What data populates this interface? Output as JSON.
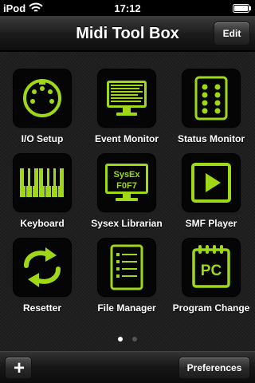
{
  "status_bar": {
    "carrier": "iPod",
    "time": "17:12",
    "wifi_icon": "wifi-icon",
    "battery_icon": "battery-icon"
  },
  "nav": {
    "title": "Midi Tool Box",
    "edit_label": "Edit"
  },
  "theme": {
    "accent": "#9ed816",
    "background": "#1c1c1c"
  },
  "tools": [
    {
      "label": "I/O Setup",
      "icon": "midi-din-connector-icon"
    },
    {
      "label": "Event Monitor",
      "icon": "monitor-binary-icon"
    },
    {
      "label": "Status Monitor",
      "icon": "status-lights-icon"
    },
    {
      "label": "Keyboard",
      "icon": "piano-keys-icon"
    },
    {
      "label": "Sysex Librarian",
      "icon": "sysex-monitor-icon",
      "icon_text": [
        "SysEx",
        "F0F7"
      ]
    },
    {
      "label": "SMF Player",
      "icon": "play-icon"
    },
    {
      "label": "Resetter",
      "icon": "reset-arrows-icon"
    },
    {
      "label": "File Manager",
      "icon": "file-list-icon"
    },
    {
      "label": "Program Change",
      "icon": "pc-notepad-icon",
      "icon_text": [
        "PC"
      ]
    }
  ],
  "pager": {
    "current": 1,
    "total": 2
  },
  "toolbar": {
    "add_label": "+",
    "preferences_label": "Preferences"
  }
}
